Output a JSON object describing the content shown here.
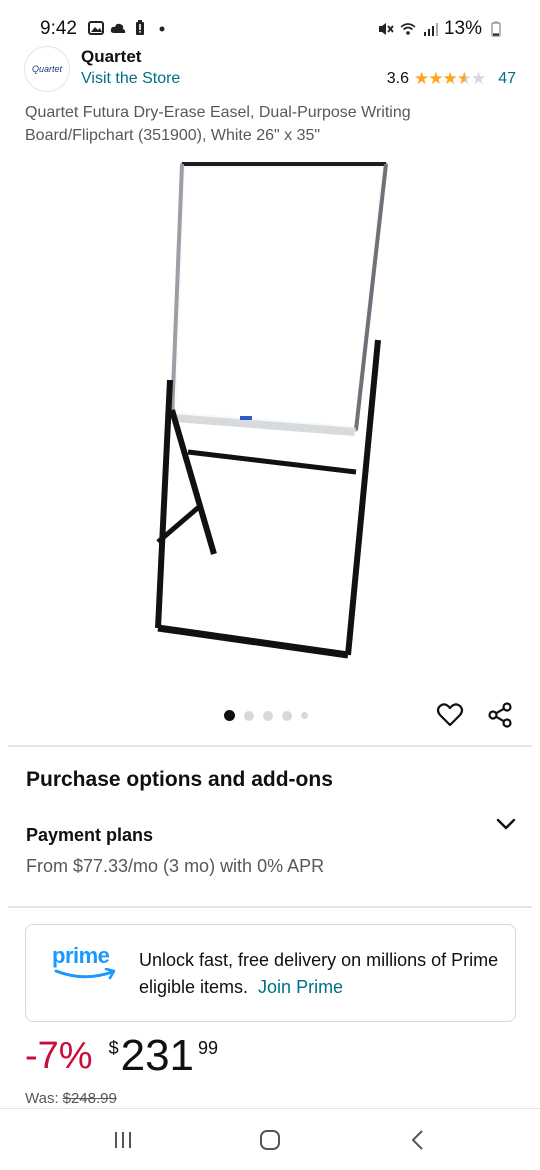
{
  "status_bar": {
    "time": "9:42",
    "battery": "13%",
    "icons": [
      "gallery-icon",
      "cloud-icon",
      "battery-alert-icon",
      "dot-icon",
      "mute-icon",
      "wifi-icon",
      "signal-icon",
      "battery-icon"
    ]
  },
  "brand": {
    "logo_text": "Quartet",
    "name": "Quartet",
    "store_link": "Visit the Store",
    "rating_value": "3.6",
    "rating_stars": 3.6,
    "rating_count": "47"
  },
  "product": {
    "title": "Quartet Futura Dry-Erase Easel, Dual-Purpose Writing Board/Flipchart (351900), White 26\" x 35\"",
    "image_icon": "whiteboard-easel-image",
    "carousel_count": 5,
    "carousel_active": 1
  },
  "actions": {
    "favorite_icon": "heart-icon",
    "share_icon": "share-icon"
  },
  "purchase": {
    "section_title": "Purchase options and add-ons",
    "payment_title": "Payment plans",
    "payment_text": "From $77.33/mo (3 mo) with 0% APR"
  },
  "prime": {
    "logo": "prime",
    "message": "Unlock fast, free delivery on millions of Prime eligible items.",
    "join_link": "Join Prime"
  },
  "price": {
    "discount": "-7%",
    "currency": "$",
    "whole": "231",
    "fraction": "99",
    "was_label": "Was:",
    "was_price": "$248.99"
  },
  "colors": {
    "link": "#007185",
    "star": "#ffa41c",
    "discount": "#cc0c39",
    "prime": "#1a98ff"
  },
  "nav": [
    "recent-apps-icon",
    "home-icon",
    "back-icon"
  ]
}
